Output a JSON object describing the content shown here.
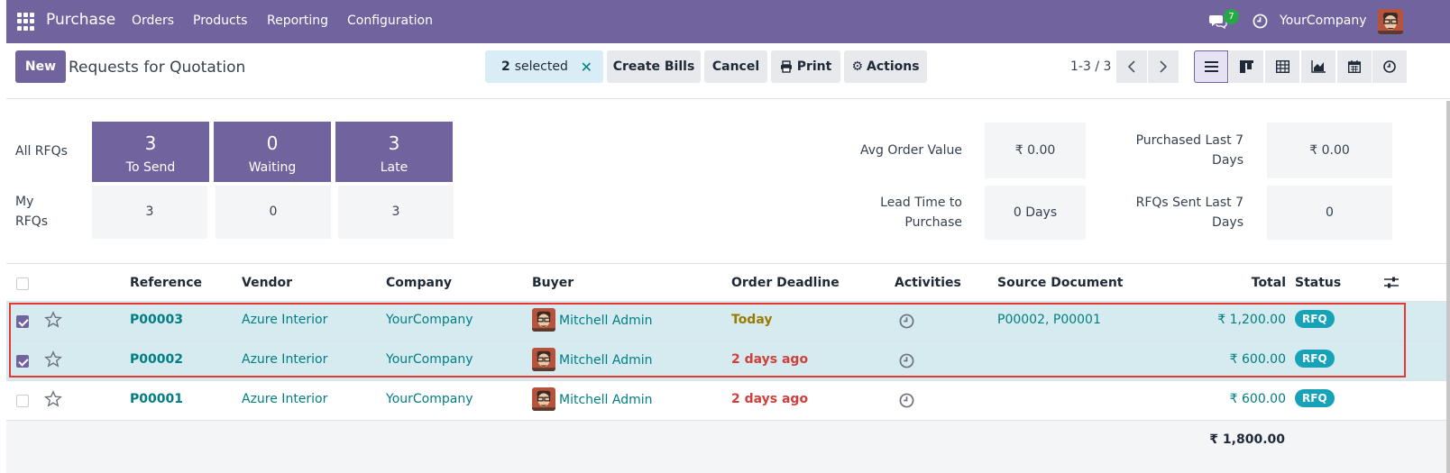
{
  "navbar": {
    "app_name": "Purchase",
    "menu": [
      "Orders",
      "Products",
      "Reporting",
      "Configuration"
    ],
    "message_count": "7",
    "company": "YourCompany",
    "icons": [
      "apps-grid-icon",
      "chat-icon",
      "clock-icon",
      "user-avatar"
    ],
    "color": "#71639e"
  },
  "control_panel": {
    "new_label": "New",
    "title": "Requests for Quotation",
    "selected_count": "2",
    "selected_label": "selected",
    "create_bills_label": "Create Bills",
    "cancel_label": "Cancel",
    "print_label": "Print",
    "actions_label": "Actions",
    "pager": "1-3 / 3"
  },
  "dashboard": {
    "all_rfqs_label": "All RFQs",
    "my_rfqs_label": "My RFQs",
    "tiles": [
      {
        "value": "3",
        "label": "To Send",
        "mine": "3"
      },
      {
        "value": "0",
        "label": "Waiting",
        "mine": "0"
      },
      {
        "value": "3",
        "label": "Late",
        "mine": "3"
      }
    ],
    "kpis": {
      "avg_order_value_label": "Avg Order Value",
      "avg_order_value": "₹ 0.00",
      "purchased_last7_label": "Purchased Last 7 Days",
      "purchased_last7": "₹ 0.00",
      "lead_time_label": "Lead Time to Purchase",
      "lead_time": "0 Days",
      "rfqs_sent_label": "RFQs Sent Last 7 Days",
      "rfqs_sent": "0"
    }
  },
  "table": {
    "columns": [
      "Reference",
      "Vendor",
      "Company",
      "Buyer",
      "Order Deadline",
      "Activities",
      "Source Document",
      "Total",
      "Status"
    ],
    "rows": [
      {
        "selected": true,
        "reference": "P00003",
        "vendor": "Azure Interior",
        "company": "YourCompany",
        "buyer": "Mitchell Admin",
        "deadline": "Today",
        "source": "P00002, P00001",
        "total": "₹ 1,200.00",
        "status": "RFQ"
      },
      {
        "selected": true,
        "reference": "P00002",
        "vendor": "Azure Interior",
        "company": "YourCompany",
        "buyer": "Mitchell Admin",
        "deadline": "2 days ago",
        "source": "",
        "total": "₹ 600.00",
        "status": "RFQ"
      },
      {
        "selected": false,
        "reference": "P00001",
        "vendor": "Azure Interior",
        "company": "YourCompany",
        "buyer": "Mitchell Admin",
        "deadline": "2 days ago",
        "source": "",
        "total": "₹ 600.00",
        "status": "RFQ"
      }
    ],
    "grand_total": "₹ 1,800.00"
  }
}
